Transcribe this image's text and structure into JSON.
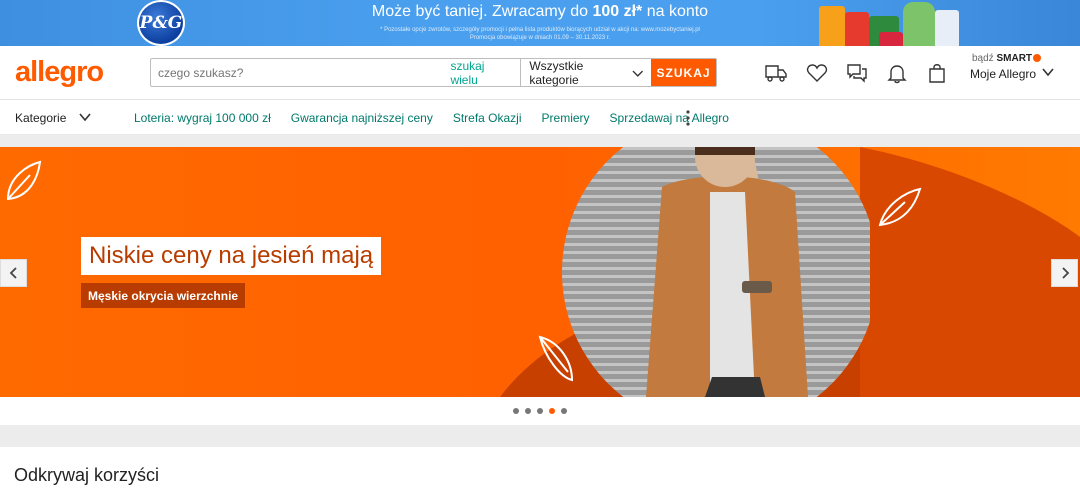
{
  "promo": {
    "brand": "P&G",
    "title_pre": "Może być taniej. Zwracamy do ",
    "title_bold": "100 zł*",
    "title_post": " na konto",
    "fine_line1": "* Pozostałe opcje zwrotów, szczegóły promocji i pełna lista produktów biorących udział w akcji na: www.mozebyctaniej.pl",
    "fine_line2": "Promocja obowiązuje w dniach 01.09 – 30.11.2023 r."
  },
  "header": {
    "logo": "allegro",
    "search_placeholder": "czego szukasz?",
    "search_many": "szukaj wielu",
    "category_select": "Wszystkie kategorie",
    "search_button": "SZUKAJ",
    "smart_prefix": "bądź",
    "smart_label": "SMART",
    "account_label": "Moje Allegro",
    "icons": [
      "delivery-truck-icon",
      "heart-icon",
      "chat-icon",
      "bell-icon",
      "cart-icon"
    ]
  },
  "nav": {
    "categories": "Kategorie",
    "links": [
      "Loteria: wygraj 100 000 zł",
      "Gwarancja najniższej ceny",
      "Strefa Okazji",
      "Premiery",
      "Sprzedawaj na Allegro"
    ]
  },
  "hero": {
    "title": "Niskie ceny na jesień mają",
    "subtitle": "Męskie okrycia wierzchnie",
    "colors": {
      "orange": "#ff6000",
      "dark_orange": "#b83c00"
    },
    "slides_count": 5,
    "active_slide": 4
  },
  "section": {
    "title": "Odkrywaj korzyści"
  }
}
